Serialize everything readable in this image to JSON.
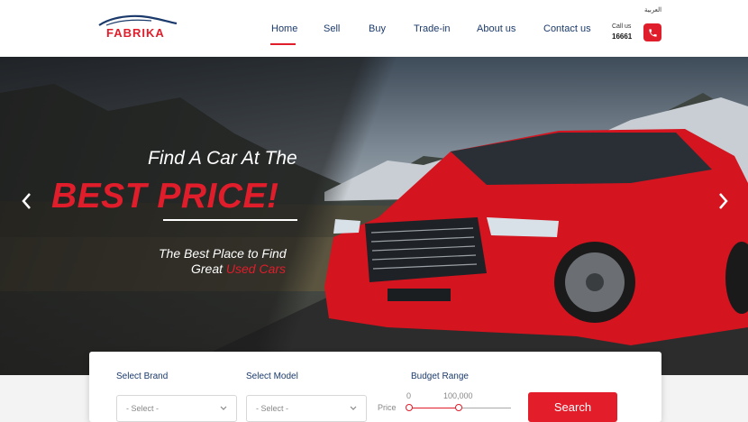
{
  "header": {
    "logo_text": "FABRIKA",
    "nav": [
      {
        "label": "Home",
        "active": true
      },
      {
        "label": "Sell",
        "active": false
      },
      {
        "label": "Buy",
        "active": false
      },
      {
        "label": "Trade-in",
        "active": false
      },
      {
        "label": "About us",
        "active": false
      },
      {
        "label": "Contact us",
        "active": false
      }
    ],
    "call_label": "Call us",
    "call_number": "16661",
    "language": "العربية",
    "phone_icon": "phone-icon"
  },
  "hero": {
    "headline_line1": "Find A Car At The",
    "headline_line2": "BEST PRICE!",
    "sub_line1": "The Best Place to Find",
    "sub_line2_prefix": "Great",
    "sub_line2_highlight": "Used Cars",
    "prev_icon": "chevron-left-icon",
    "next_icon": "chevron-right-icon"
  },
  "search": {
    "brand_label": "Select Brand",
    "brand_value": "- Select -",
    "model_label": "Select Model",
    "model_value": "- Select -",
    "budget_label": "Budget Range",
    "price_label": "Price",
    "range_min": "0",
    "range_max": "100,000",
    "button_label": "Search"
  },
  "colors": {
    "accent": "#e01d2b",
    "nav_text": "#1b3a6b"
  }
}
